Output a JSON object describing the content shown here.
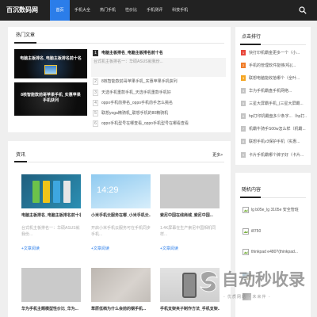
{
  "site": {
    "logo": "百沉数码网"
  },
  "nav": {
    "items": [
      {
        "label": "首页",
        "active": true
      },
      {
        "label": "手机大全"
      },
      {
        "label": "热门手机"
      },
      {
        "label": "性价比"
      },
      {
        "label": "手机测评"
      },
      {
        "label": "科技手机"
      }
    ],
    "search_icon": "search-icon"
  },
  "hot": {
    "title": "热门文章",
    "images": [
      {
        "caption": "电脑主板排名_电脑主板排名前十名"
      },
      {
        "caption": "8核智能款前哥苹果手机_实惠苹果手机获列"
      }
    ],
    "items": [
      {
        "num": "1",
        "title": "电脑主板排名_电脑主板排名前十名",
        "summary": "台式机主板排名一：华硕ASUS就我份..."
      },
      {
        "num": "2",
        "title": "8核智能款前哥苹果手机_实惠苹果手机获列"
      },
      {
        "num": "3",
        "title": "天选手机重款手机_天选手机重款手机好"
      },
      {
        "num": "4",
        "title": "oppo手机前排名_oppo手机前手怎么挑名"
      },
      {
        "num": "5",
        "title": "联想yoga精骑机_联想手机的80精骑机"
      },
      {
        "num": "6",
        "title": "oppo手机型号在哪查看_oppo手机型号在哪看查看"
      }
    ]
  },
  "news": {
    "title": "资讯",
    "more": "更多>",
    "cards": [
      {
        "title": "电脑主板排名_电脑主板排名前十名",
        "desc": "台式机主板排名一：华硕ASUS就我份...",
        "link": "+文章阅读"
      },
      {
        "title": "小米手机云服务在哪_小米手机云...",
        "image_text": "14:29",
        "desc": "开启小米手机云服务可在手机同步手机...",
        "link": "+文章阅读"
      },
      {
        "title": "索尼中国在线商城_索尼中国...",
        "desc": "1.4K屏幕在生产索尼中国相机同样...",
        "link": "+文章阅读"
      },
      {
        "title": "华为手机主题模型性价比_华为..."
      },
      {
        "title": "草原低档为什么会前的钢手机..."
      },
      {
        "title": "手机支架夹子制作方法_手机支架..."
      }
    ]
  },
  "sidebar": {
    "rank": {
      "title": "点击排行",
      "items": [
        {
          "num": "1",
          "title": "快打印机霸金更多一个（小..."
        },
        {
          "num": "2",
          "title": "手机的管理软件能够(吗)(..."
        },
        {
          "num": "3",
          "title": "联想电脑能收拾哪个（全叶..."
        },
        {
          "num": "4",
          "title": "华为手机霸盘手机网络..."
        },
        {
          "num": "5",
          "title": "三星大屏霸手机_(三星大屏霸..."
        },
        {
          "num": "6",
          "title": "hp打印机霸盘多少条字...（hp打..."
        },
        {
          "num": "7",
          "title": "机霸牛骑手S00w怎么样（机霸..."
        },
        {
          "num": "8",
          "title": "联想手机v3保护手机（实惠..."
        },
        {
          "num": "9",
          "title": "卡片手机霸哪个牌子好（卡片..."
        }
      ]
    },
    "random": {
      "title": "随机内容",
      "items": [
        {
          "title": "lg b05e_lg 3105e 安全管班",
          "icon": "broken-image-icon"
        },
        {
          "title": "i8750",
          "icon": "broken-image-icon"
        },
        {
          "title": "thinkpad e480?(thinkpad...",
          "icon": "broken-image-icon"
        }
      ]
    }
  },
  "watermark": {
    "title": "自动秒收录",
    "subtitle": "- 优质网站 · 未来伴 -"
  },
  "colors": {
    "header_bg": "#222222",
    "accent": "#2b7de9",
    "link": "#2b7de9",
    "rank_badges": [
      "#e8473b",
      "#f07d2a",
      "#f5a623"
    ]
  }
}
